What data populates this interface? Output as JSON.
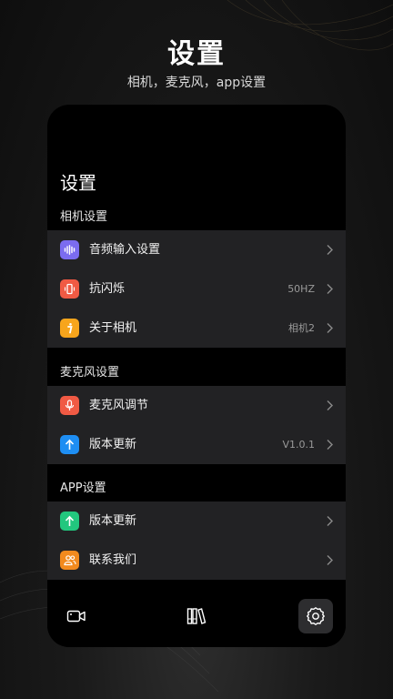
{
  "hero": {
    "title": "设置",
    "subtitle": "相机，麦克风，app设置"
  },
  "screen": {
    "title": "设置"
  },
  "sections": [
    {
      "label": "相机设置",
      "items": [
        {
          "label": "音频输入设置",
          "value": "",
          "icon": "audio-wave-icon",
          "color": "#7b6cf0"
        },
        {
          "label": "抗闪烁",
          "value": "50HZ",
          "icon": "vibrate-icon",
          "color": "#f05a44"
        },
        {
          "label": "关于相机",
          "value": "相机2",
          "icon": "info-icon",
          "color": "#f7a51c"
        }
      ]
    },
    {
      "label": "麦克风设置",
      "items": [
        {
          "label": "麦克风调节",
          "value": "",
          "icon": "microphone-icon",
          "color": "#f05a44"
        },
        {
          "label": "版本更新",
          "value": "V1.0.1",
          "icon": "arrow-up-icon",
          "color": "#1e8ef3"
        }
      ]
    },
    {
      "label": "APP设置",
      "items": [
        {
          "label": "版本更新",
          "value": "",
          "icon": "arrow-up-icon",
          "color": "#22c77e"
        },
        {
          "label": "联系我们",
          "value": "",
          "icon": "contacts-icon",
          "color": "#f28a1e"
        }
      ]
    }
  ],
  "tabbar": {
    "tabs": [
      {
        "icon": "camera-icon",
        "active": false
      },
      {
        "icon": "library-icon",
        "active": false
      },
      {
        "icon": "gear-icon",
        "active": true
      }
    ]
  }
}
